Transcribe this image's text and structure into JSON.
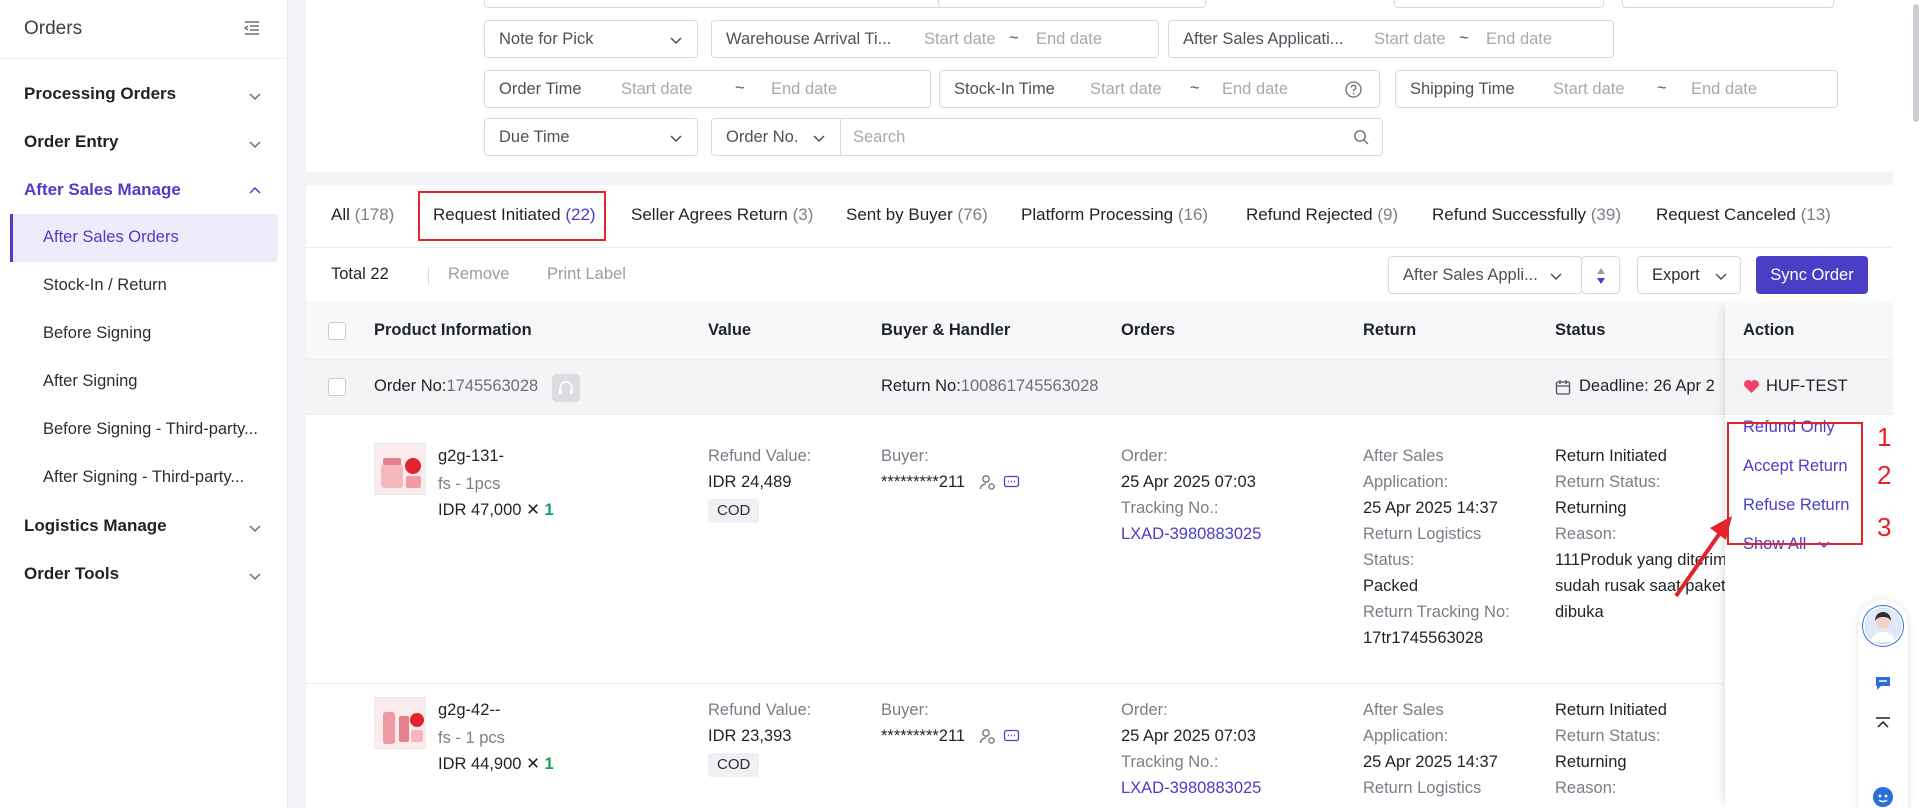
{
  "sidebar": {
    "title": "Orders",
    "groups": {
      "processing": "Processing Orders",
      "entry": "Order Entry",
      "after_sales": "After Sales Manage",
      "logistics": "Logistics Manage",
      "tools": "Order Tools"
    },
    "after_sales_items": [
      "After Sales Orders",
      "Stock-In / Return",
      "Before Signing",
      "After Signing",
      "Before Signing - Third-party...",
      "After Signing - Third-party..."
    ]
  },
  "filters": {
    "note_for_pick": "Note for Pick",
    "warehouse_arrival": "Warehouse Arrival Ti...",
    "after_sales_app": "After Sales Applicati...",
    "order_time": "Order Time",
    "stock_in_time": "Stock-In Time",
    "shipping_time": "Shipping Time",
    "due_time": "Due Time",
    "order_no": "Order No.",
    "start_date": "Start date",
    "end_date": "End date",
    "tilde": "~",
    "search_placeholder": "Search"
  },
  "tabs": [
    {
      "label": "All",
      "count": "(178)"
    },
    {
      "label": "Request Initiated",
      "count": "(22)"
    },
    {
      "label": "Seller Agrees Return",
      "count": "(3)"
    },
    {
      "label": "Sent by Buyer",
      "count": "(76)"
    },
    {
      "label": "Platform Processing",
      "count": "(16)"
    },
    {
      "label": "Refund Rejected",
      "count": "(9)"
    },
    {
      "label": "Refund Successfully",
      "count": "(39)"
    },
    {
      "label": "Request Canceled",
      "count": "(13)"
    }
  ],
  "toolbar": {
    "total": "Total 22",
    "remove": "Remove",
    "print_label": "Print Label",
    "sort_select": "After Sales Appli...",
    "export": "Export",
    "sync": "Sync Order"
  },
  "table": {
    "headers": {
      "product": "Product Information",
      "value": "Value",
      "buyer": "Buyer & Handler",
      "orders": "Orders",
      "return": "Return",
      "status": "Status",
      "action": "Action"
    },
    "order_head": {
      "order_no_label": "Order No:",
      "order_no": "1745563028",
      "return_no_label": "Return No:",
      "return_no": "100861745563028",
      "deadline_label": "Deadline:",
      "deadline": "26 Apr 2",
      "shop": "HUF-TEST"
    },
    "rows": [
      {
        "name": "g2g-131-",
        "variant": "fs - 1pcs",
        "price": "IDR 47,000",
        "times": "✕",
        "qty": "1",
        "refund_label": "Refund Value:",
        "refund": "IDR 24,489",
        "payment": "COD",
        "buyer_label": "Buyer:",
        "buyer": "*********211",
        "order_label": "Order:",
        "order_time": "25 Apr 2025 07:03",
        "tracking_label": "Tracking No.:",
        "tracking": "LXAD-3980883025",
        "app_label_1": "After Sales",
        "app_label_2": "Application:",
        "app_time": "25 Apr 2025 14:37",
        "rl_label_1": "Return Logistics",
        "rl_label_2": "Status:",
        "rl_status": "Packed",
        "rt_label": "Return Tracking No:",
        "rt": "17tr1745563028",
        "status": "Return Initiated",
        "return_status_label": "Return Status:",
        "return_status": "Returning",
        "reason_label": "Reason:",
        "reason_1": "111Produk yang diterim",
        "reason_2": "sudah rusak saat paket",
        "reason_3": "dibuka"
      },
      {
        "name": "g2g-42--",
        "variant": "fs - 1 pcs",
        "price": "IDR 44,900",
        "times": "✕",
        "qty": "1",
        "refund_label": "Refund Value:",
        "refund": "IDR 23,393",
        "payment": "COD",
        "buyer_label": "Buyer:",
        "buyer": "*********211",
        "order_label": "Order:",
        "order_time": "25 Apr 2025 07:03",
        "tracking_label": "Tracking No.:",
        "tracking": "LXAD-3980883025",
        "app_label_1": "After Sales",
        "app_label_2": "Application:",
        "app_time": "25 Apr 2025 14:37",
        "rl_label_1": "Return Logistics",
        "status": "Return Initiated",
        "return_status_label": "Return Status:",
        "return_status": "Returning",
        "reason_label": "Reason:"
      }
    ]
  },
  "actions": {
    "refund_only": "Refund Only",
    "accept_return": "Accept Return",
    "refuse_return": "Refuse Return",
    "show_all": "Show All"
  },
  "annotations": {
    "n1": "1",
    "n2": "2",
    "n3": "3"
  },
  "colors": {
    "accent": "#4a3ec7",
    "highlight": "#e0242a",
    "qty": "#18a058"
  }
}
